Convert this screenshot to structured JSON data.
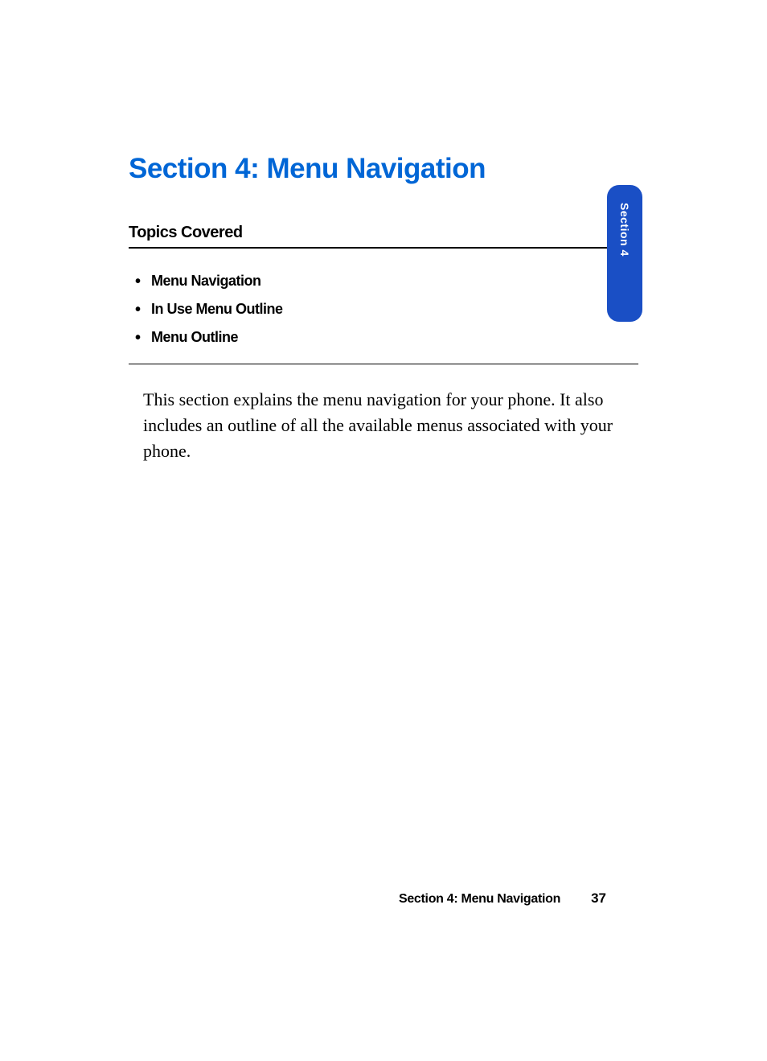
{
  "section": {
    "title": "Section 4: Menu Navigation",
    "topics_heading": "Topics Covered",
    "bullets": {
      "0": "Menu Navigation",
      "1": "In Use Menu Outline",
      "2": "Menu Outline"
    },
    "body": "This section explains the menu navigation for your phone. It also includes an outline of all the available menus associated with your phone."
  },
  "side_tab": {
    "label": "Section 4"
  },
  "footer": {
    "title": "Section 4: Menu Navigation",
    "page": "37"
  }
}
